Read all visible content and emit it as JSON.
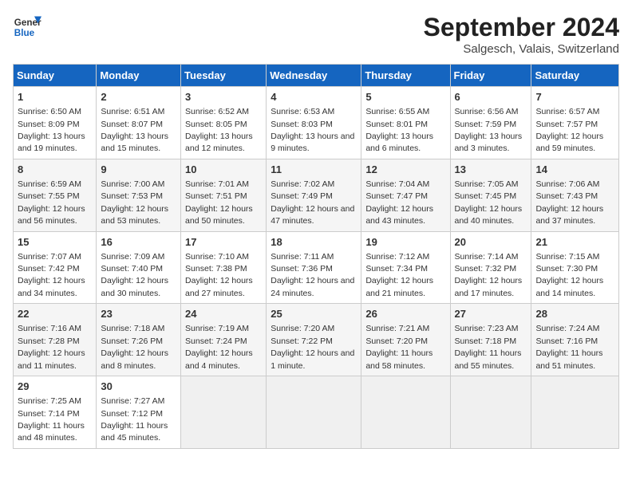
{
  "header": {
    "logo": {
      "line1": "General",
      "line2": "Blue"
    },
    "title": "September 2024",
    "location": "Salgesch, Valais, Switzerland"
  },
  "calendar": {
    "columns": [
      "Sunday",
      "Monday",
      "Tuesday",
      "Wednesday",
      "Thursday",
      "Friday",
      "Saturday"
    ],
    "weeks": [
      [
        {
          "day": 1,
          "sunrise": "6:50 AM",
          "sunset": "8:09 PM",
          "daylight": "13 hours and 19 minutes."
        },
        {
          "day": 2,
          "sunrise": "6:51 AM",
          "sunset": "8:07 PM",
          "daylight": "13 hours and 15 minutes."
        },
        {
          "day": 3,
          "sunrise": "6:52 AM",
          "sunset": "8:05 PM",
          "daylight": "13 hours and 12 minutes."
        },
        {
          "day": 4,
          "sunrise": "6:53 AM",
          "sunset": "8:03 PM",
          "daylight": "13 hours and 9 minutes."
        },
        {
          "day": 5,
          "sunrise": "6:55 AM",
          "sunset": "8:01 PM",
          "daylight": "13 hours and 6 minutes."
        },
        {
          "day": 6,
          "sunrise": "6:56 AM",
          "sunset": "7:59 PM",
          "daylight": "13 hours and 3 minutes."
        },
        {
          "day": 7,
          "sunrise": "6:57 AM",
          "sunset": "7:57 PM",
          "daylight": "12 hours and 59 minutes."
        }
      ],
      [
        {
          "day": 8,
          "sunrise": "6:59 AM",
          "sunset": "7:55 PM",
          "daylight": "12 hours and 56 minutes."
        },
        {
          "day": 9,
          "sunrise": "7:00 AM",
          "sunset": "7:53 PM",
          "daylight": "12 hours and 53 minutes."
        },
        {
          "day": 10,
          "sunrise": "7:01 AM",
          "sunset": "7:51 PM",
          "daylight": "12 hours and 50 minutes."
        },
        {
          "day": 11,
          "sunrise": "7:02 AM",
          "sunset": "7:49 PM",
          "daylight": "12 hours and 47 minutes."
        },
        {
          "day": 12,
          "sunrise": "7:04 AM",
          "sunset": "7:47 PM",
          "daylight": "12 hours and 43 minutes."
        },
        {
          "day": 13,
          "sunrise": "7:05 AM",
          "sunset": "7:45 PM",
          "daylight": "12 hours and 40 minutes."
        },
        {
          "day": 14,
          "sunrise": "7:06 AM",
          "sunset": "7:43 PM",
          "daylight": "12 hours and 37 minutes."
        }
      ],
      [
        {
          "day": 15,
          "sunrise": "7:07 AM",
          "sunset": "7:42 PM",
          "daylight": "12 hours and 34 minutes."
        },
        {
          "day": 16,
          "sunrise": "7:09 AM",
          "sunset": "7:40 PM",
          "daylight": "12 hours and 30 minutes."
        },
        {
          "day": 17,
          "sunrise": "7:10 AM",
          "sunset": "7:38 PM",
          "daylight": "12 hours and 27 minutes."
        },
        {
          "day": 18,
          "sunrise": "7:11 AM",
          "sunset": "7:36 PM",
          "daylight": "12 hours and 24 minutes."
        },
        {
          "day": 19,
          "sunrise": "7:12 AM",
          "sunset": "7:34 PM",
          "daylight": "12 hours and 21 minutes."
        },
        {
          "day": 20,
          "sunrise": "7:14 AM",
          "sunset": "7:32 PM",
          "daylight": "12 hours and 17 minutes."
        },
        {
          "day": 21,
          "sunrise": "7:15 AM",
          "sunset": "7:30 PM",
          "daylight": "12 hours and 14 minutes."
        }
      ],
      [
        {
          "day": 22,
          "sunrise": "7:16 AM",
          "sunset": "7:28 PM",
          "daylight": "12 hours and 11 minutes."
        },
        {
          "day": 23,
          "sunrise": "7:18 AM",
          "sunset": "7:26 PM",
          "daylight": "12 hours and 8 minutes."
        },
        {
          "day": 24,
          "sunrise": "7:19 AM",
          "sunset": "7:24 PM",
          "daylight": "12 hours and 4 minutes."
        },
        {
          "day": 25,
          "sunrise": "7:20 AM",
          "sunset": "7:22 PM",
          "daylight": "12 hours and 1 minute."
        },
        {
          "day": 26,
          "sunrise": "7:21 AM",
          "sunset": "7:20 PM",
          "daylight": "11 hours and 58 minutes."
        },
        {
          "day": 27,
          "sunrise": "7:23 AM",
          "sunset": "7:18 PM",
          "daylight": "11 hours and 55 minutes."
        },
        {
          "day": 28,
          "sunrise": "7:24 AM",
          "sunset": "7:16 PM",
          "daylight": "11 hours and 51 minutes."
        }
      ],
      [
        {
          "day": 29,
          "sunrise": "7:25 AM",
          "sunset": "7:14 PM",
          "daylight": "11 hours and 48 minutes."
        },
        {
          "day": 30,
          "sunrise": "7:27 AM",
          "sunset": "7:12 PM",
          "daylight": "11 hours and 45 minutes."
        },
        null,
        null,
        null,
        null,
        null
      ]
    ]
  }
}
